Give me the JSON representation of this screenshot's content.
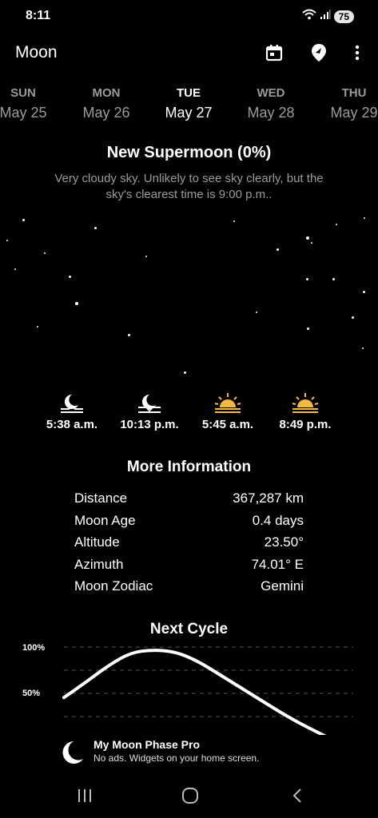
{
  "status_bar": {
    "time": "8:11",
    "battery": "75",
    "icons": [
      "wifi-icon",
      "signal-icon",
      "battery-icon"
    ]
  },
  "app_bar": {
    "title": "Moon",
    "actions": [
      "calendar-icon",
      "location-pin-icon",
      "more-vert-icon"
    ]
  },
  "days": [
    {
      "dow": "SUN",
      "date": "May 25",
      "active": false
    },
    {
      "dow": "MON",
      "date": "May 26",
      "active": false
    },
    {
      "dow": "TUE",
      "date": "May 27",
      "active": true
    },
    {
      "dow": "WED",
      "date": "May 28",
      "active": false
    },
    {
      "dow": "THU",
      "date": "May 29",
      "active": false
    }
  ],
  "phase": {
    "title": "New Supermoon (0%)",
    "description": "Very cloudy sky. Unlikely to see sky clearly, but the sky's clearest time is 9:00 p.m.."
  },
  "events": [
    {
      "icon": "moonrise-icon",
      "time": "5:38 a.m.",
      "color": "#ffffff"
    },
    {
      "icon": "moonset-icon",
      "time": "10:13 p.m.",
      "color": "#ffffff"
    },
    {
      "icon": "sunrise-icon",
      "time": "5:45 a.m.",
      "color": "#f5b942"
    },
    {
      "icon": "sunset-icon",
      "time": "8:49 p.m.",
      "color": "#f5b942"
    }
  ],
  "more_info": {
    "title": "More Information",
    "rows": [
      {
        "label": "Distance",
        "value": "367,287 km"
      },
      {
        "label": "Moon Age",
        "value": "0.4 days"
      },
      {
        "label": "Altitude",
        "value": "23.50°"
      },
      {
        "label": "Azimuth",
        "value": "74.01° E"
      },
      {
        "label": "Moon Zodiac",
        "value": "Gemini"
      }
    ]
  },
  "next_cycle": {
    "title": "Next Cycle",
    "y_ticks": [
      "100%",
      "50%"
    ]
  },
  "chart_data": {
    "type": "line",
    "title": "Next Cycle",
    "xlabel": "",
    "ylabel": "",
    "ylim": [
      0,
      100
    ],
    "grid": true,
    "series": [
      {
        "values": [
          45,
          62,
          80,
          94,
          97,
          95,
          85,
          70,
          55,
          40,
          25,
          12,
          0
        ]
      }
    ]
  },
  "promo": {
    "title": "My Moon Phase Pro",
    "subtitle": "No ads. Widgets on your home screen."
  },
  "nav_bar": {
    "buttons": [
      "recents-icon",
      "home-icon",
      "back-icon"
    ]
  },
  "colors": {
    "background": "#000000",
    "muted_text": "#9a9a9a",
    "sun_accent": "#f5b942"
  }
}
